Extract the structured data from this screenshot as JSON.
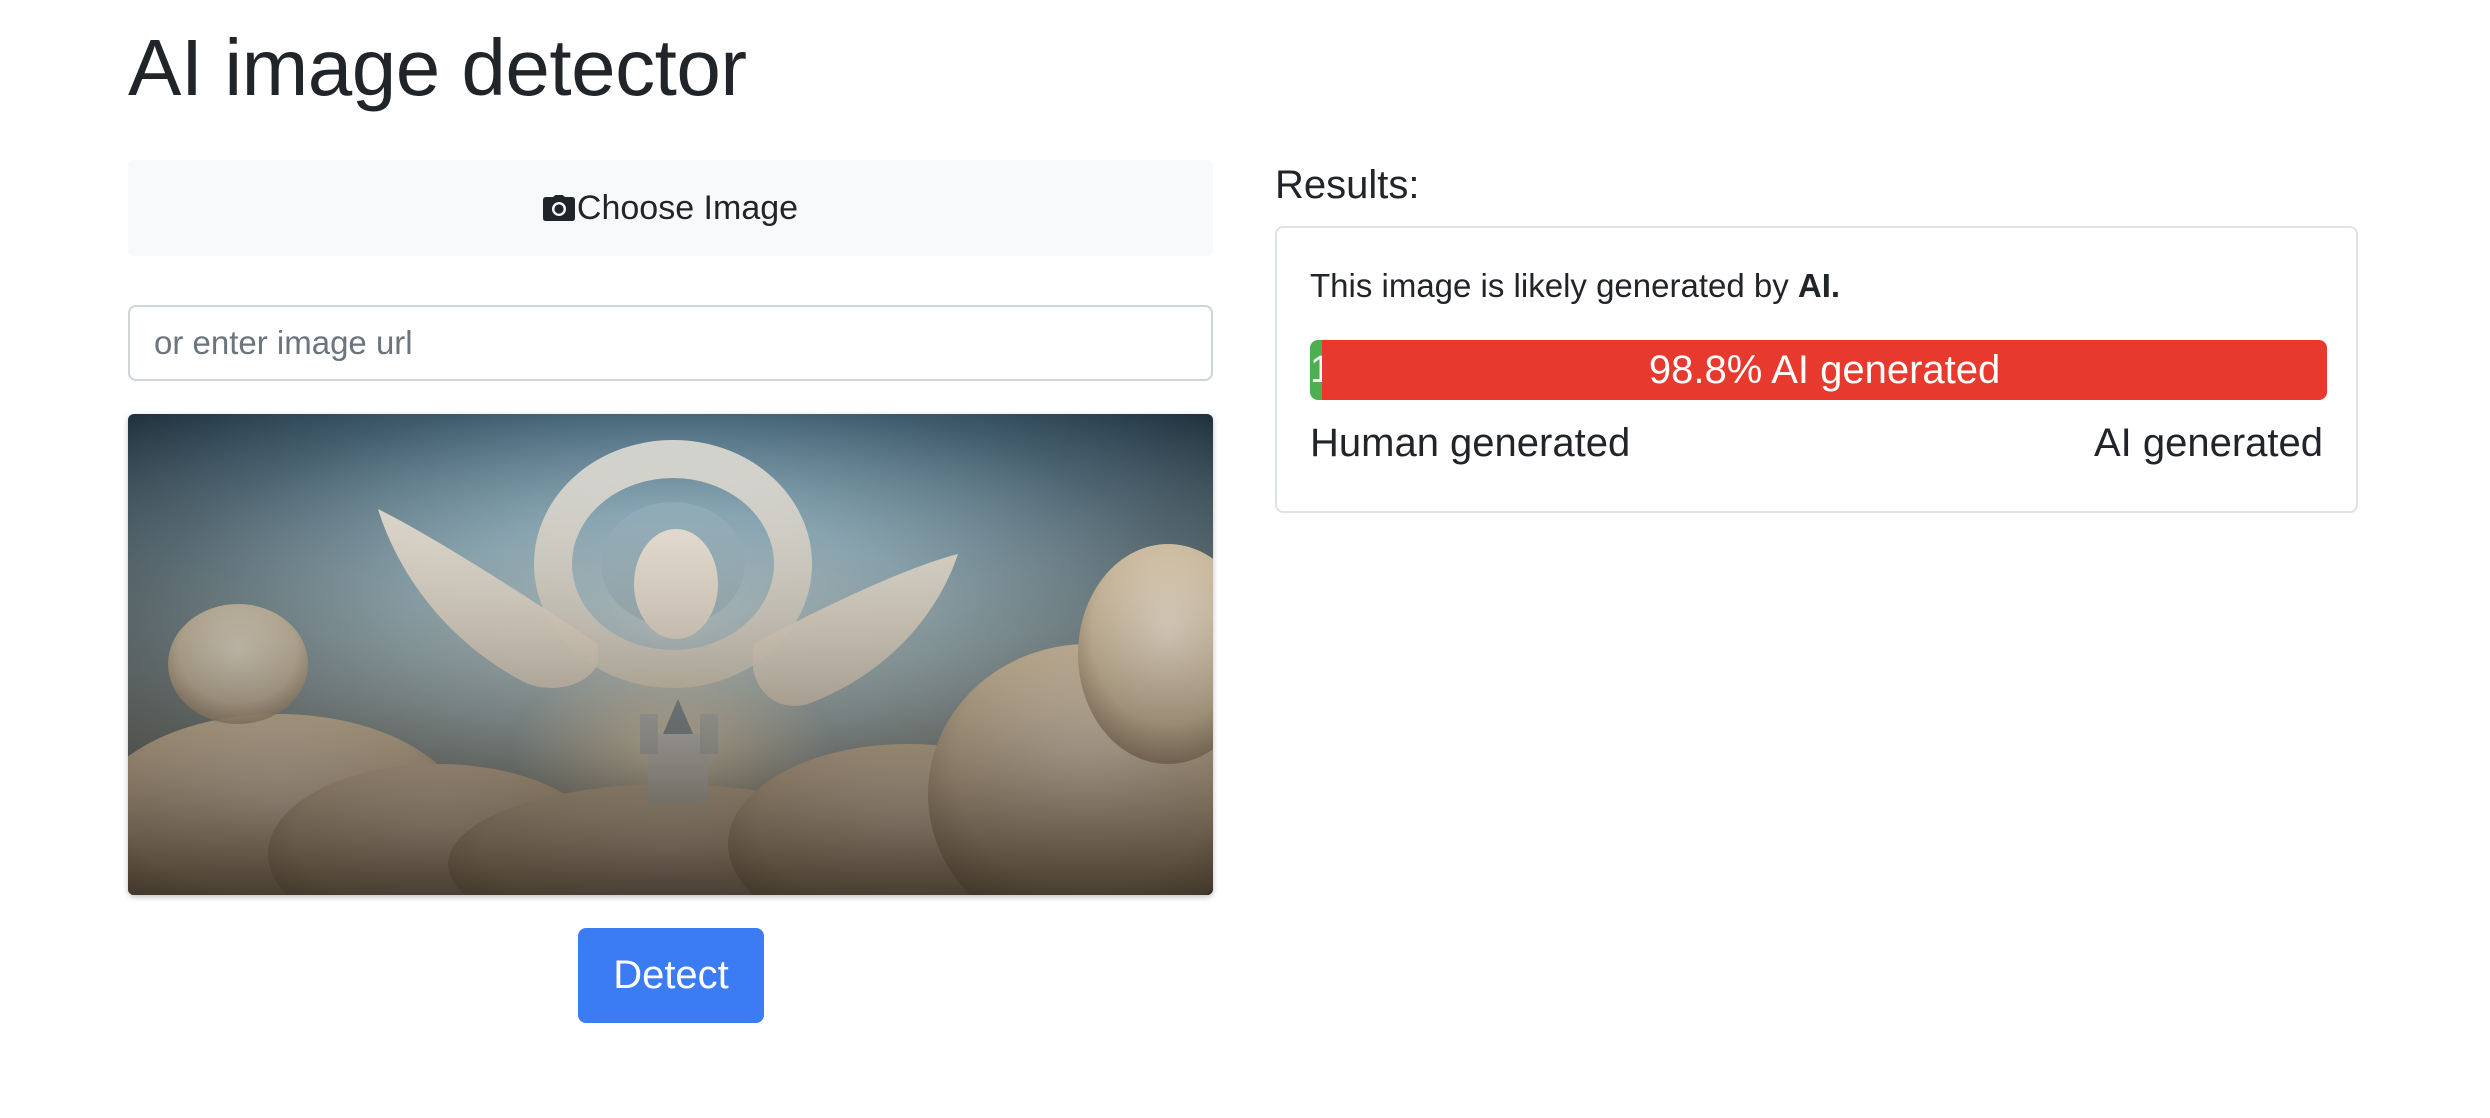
{
  "page": {
    "title": "AI image detector"
  },
  "upload": {
    "choose_label": "Choose Image",
    "choose_icon": "camera-icon",
    "url_placeholder": "or enter image url",
    "url_value": "",
    "preview_alt": "uploaded image preview",
    "detect_label": "Detect"
  },
  "results": {
    "heading": "Results:",
    "verdict_prefix": "This image is likely generated by ",
    "verdict_strong": "AI.",
    "human_percent": 1.2,
    "ai_percent": 98.8,
    "human_bar_label": "1",
    "ai_bar_label": "98.8% AI generated",
    "scale_left": "Human generated",
    "scale_right": "AI generated"
  },
  "colors": {
    "accent_button": "#3b7cf5",
    "human_bar": "#4caf50",
    "ai_bar": "#e8392f",
    "choose_bg": "#f8f9fa"
  }
}
